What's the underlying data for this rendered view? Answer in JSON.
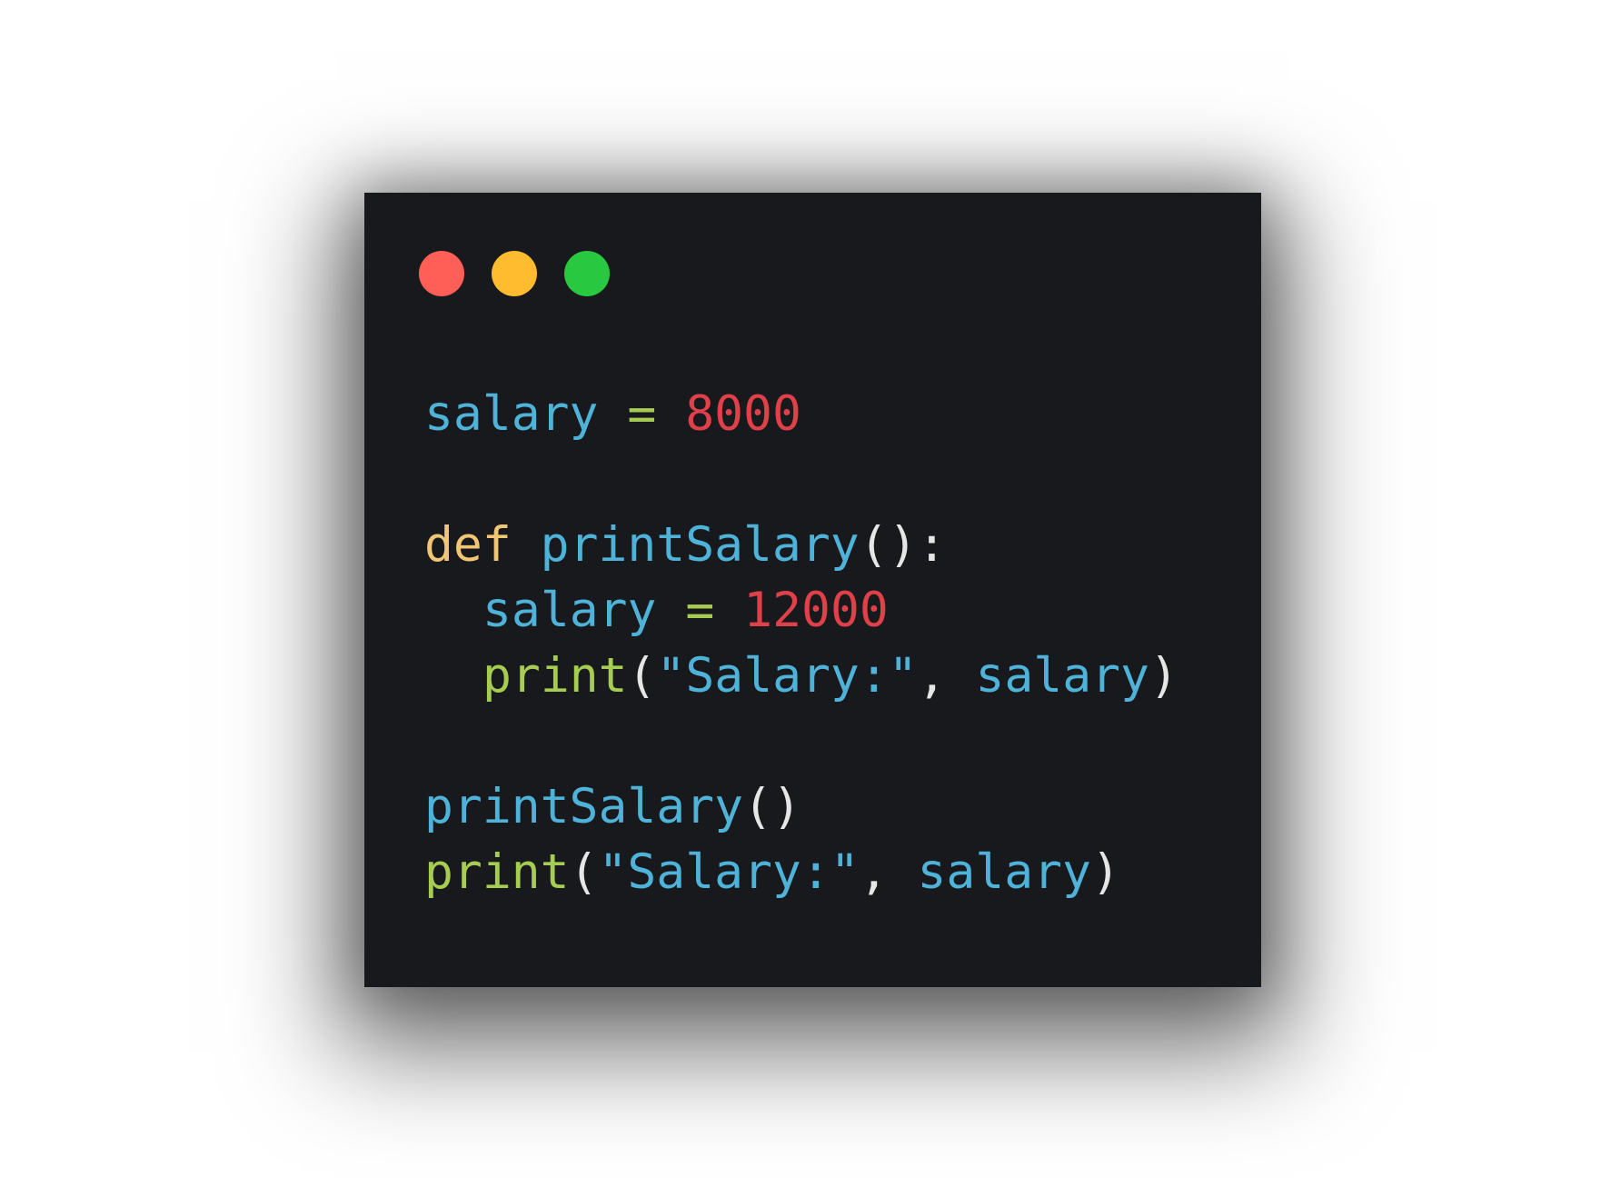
{
  "window": {
    "controls": [
      {
        "name": "close",
        "color": "#ff5f57"
      },
      {
        "name": "minimize",
        "color": "#febc2e"
      },
      {
        "name": "maximize",
        "color": "#28c840"
      }
    ]
  },
  "colors": {
    "background": "#17191c",
    "identifier": "#4fb3d9",
    "operator": "#a6cc52",
    "number": "#e0404a",
    "keyword": "#f0c674",
    "builtin": "#a6cc52",
    "punctuation": "#e6e6e6",
    "string": "#4fb3d9"
  },
  "code": {
    "lines": [
      {
        "indent": 0,
        "tokens": [
          {
            "text": "salary",
            "kind": "identifier"
          },
          {
            "text": " ",
            "kind": "punctuation"
          },
          {
            "text": "=",
            "kind": "operator"
          },
          {
            "text": " ",
            "kind": "punctuation"
          },
          {
            "text": "8000",
            "kind": "number"
          }
        ]
      },
      {
        "indent": 0,
        "tokens": []
      },
      {
        "indent": 0,
        "tokens": [
          {
            "text": "def",
            "kind": "keyword"
          },
          {
            "text": " ",
            "kind": "punctuation"
          },
          {
            "text": "printSalary",
            "kind": "identifier"
          },
          {
            "text": "():",
            "kind": "punctuation"
          }
        ]
      },
      {
        "indent": 1,
        "tokens": [
          {
            "text": "salary",
            "kind": "identifier"
          },
          {
            "text": " ",
            "kind": "punctuation"
          },
          {
            "text": "=",
            "kind": "operator"
          },
          {
            "text": " ",
            "kind": "punctuation"
          },
          {
            "text": "12000",
            "kind": "number"
          }
        ]
      },
      {
        "indent": 1,
        "tokens": [
          {
            "text": "print",
            "kind": "builtin"
          },
          {
            "text": "(",
            "kind": "punctuation"
          },
          {
            "text": "\"Salary:\"",
            "kind": "string"
          },
          {
            "text": ", ",
            "kind": "punctuation"
          },
          {
            "text": "salary",
            "kind": "identifier"
          },
          {
            "text": ")",
            "kind": "punctuation"
          }
        ]
      },
      {
        "indent": 0,
        "tokens": []
      },
      {
        "indent": 0,
        "tokens": [
          {
            "text": "printSalary",
            "kind": "identifier"
          },
          {
            "text": "()",
            "kind": "punctuation"
          }
        ]
      },
      {
        "indent": 0,
        "tokens": [
          {
            "text": "print",
            "kind": "builtin"
          },
          {
            "text": "(",
            "kind": "punctuation"
          },
          {
            "text": "\"Salary:\"",
            "kind": "string"
          },
          {
            "text": ", ",
            "kind": "punctuation"
          },
          {
            "text": "salary",
            "kind": "identifier"
          },
          {
            "text": ")",
            "kind": "punctuation"
          }
        ]
      }
    ]
  }
}
